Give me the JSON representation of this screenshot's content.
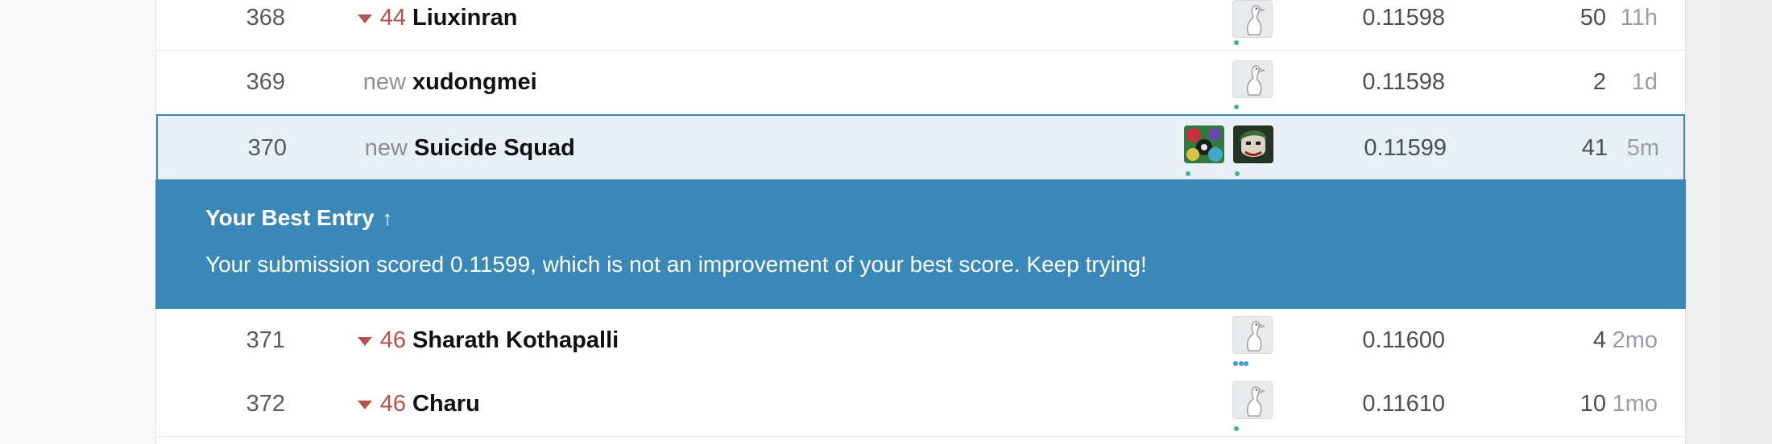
{
  "leaderboard": {
    "rows_above": [
      {
        "rank": "368",
        "delta": "44",
        "delta_type": "down",
        "name": "Liuxinran",
        "score": "0.11598",
        "entries": "50",
        "last": "11h"
      },
      {
        "rank": "369",
        "delta": "new",
        "delta_type": "new",
        "name": "xudongmei",
        "score": "0.11598",
        "entries": "2",
        "last": "1d"
      }
    ],
    "highlight_row": {
      "rank": "370",
      "delta": "new",
      "delta_type": "new",
      "name": "Suicide Squad",
      "score": "0.11599",
      "entries": "41",
      "last": "5m"
    },
    "banner": {
      "title": "Your Best Entry",
      "arrow_icon": "↑",
      "message": "Your submission scored 0.11599, which is not an improvement of your best score. Keep trying!"
    },
    "rows_below": [
      {
        "rank": "371",
        "delta": "46",
        "delta_type": "down",
        "name": "Sharath Kothapalli",
        "score": "0.11600",
        "entries": "4",
        "last": "2mo"
      },
      {
        "rank": "372",
        "delta": "46",
        "delta_type": "down",
        "name": "Charu",
        "score": "0.11610",
        "entries": "10",
        "last": "1mo"
      }
    ]
  },
  "colors": {
    "accent_blue": "#3a88b7",
    "highlight_bg": "#e9eff6",
    "delta_down": "#b4534f",
    "online_dot": "#3bb88a"
  },
  "icons": {
    "default_avatar": "goose-avatar-icon",
    "team_avatar_1": "suicide-squad-team-icon",
    "team_avatar_2": "joker-avatar-icon",
    "rank_down": "triangle-down-icon"
  }
}
